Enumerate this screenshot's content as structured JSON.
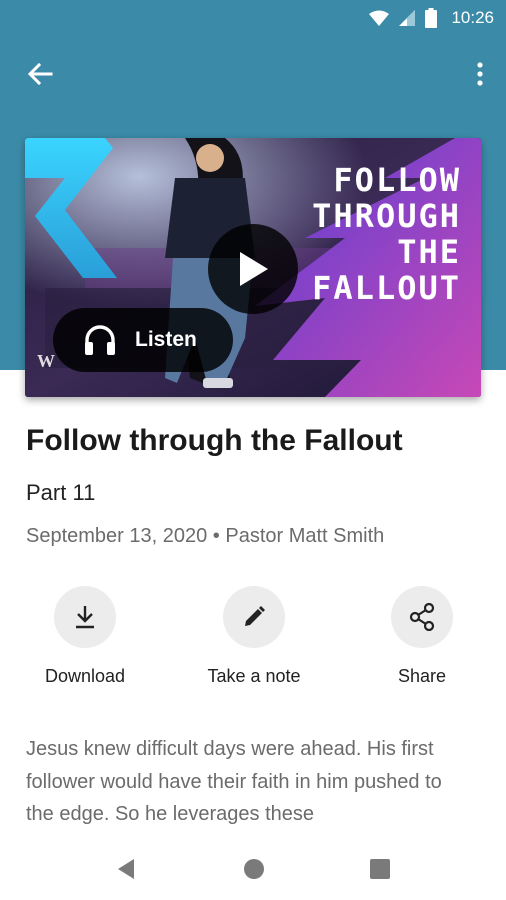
{
  "status_bar": {
    "time": "10:26",
    "icons": [
      "wifi-icon",
      "cell-signal-icon",
      "battery-icon"
    ]
  },
  "app_bar": {
    "back_icon": "arrow-back-icon",
    "more_icon": "more-vert-icon"
  },
  "media": {
    "art_title": "FOLLOW\nTHROUGH\nTHE\nFALLOUT",
    "brand_mark": "W",
    "play_icon": "play-icon",
    "listen_label": "Listen",
    "listen_icon": "headphones-icon"
  },
  "sermon": {
    "title": "Follow through the Fallout",
    "subtitle": "Part 11",
    "meta": "September 13, 2020 • Pastor Matt Smith",
    "description": "Jesus knew difficult days were ahead. His first follower would have their faith in him pushed to the edge. So he leverages these"
  },
  "actions": [
    {
      "label": "Download",
      "icon": "download-icon"
    },
    {
      "label": "Take a note",
      "icon": "pencil-icon"
    },
    {
      "label": "Share",
      "icon": "share-icon"
    }
  ],
  "nav": {
    "icons": [
      "nav-back-icon",
      "nav-home-icon",
      "nav-recents-icon"
    ]
  },
  "colors": {
    "header": "#3b8ba8",
    "accent_magenta": "#c840b8",
    "accent_cyan": "#2ec8e0"
  }
}
